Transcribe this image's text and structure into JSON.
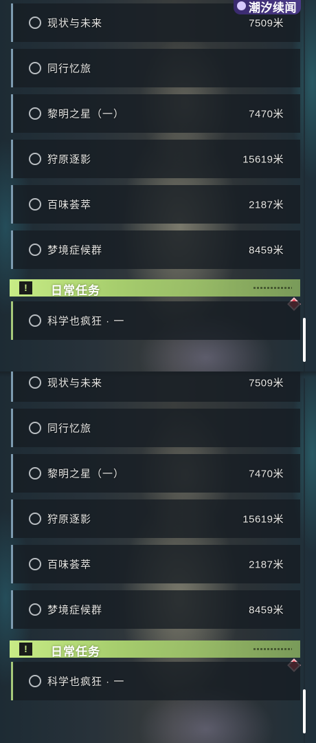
{
  "brand": {
    "name": "潮汐续闻"
  },
  "tasks": [
    {
      "name": "现状与未来",
      "distance": "7509米"
    },
    {
      "name": "同行忆旅",
      "distance": ""
    },
    {
      "name": "黎明之星（一）",
      "distance": "7470米"
    },
    {
      "name": "狩原逐影",
      "distance": "15619米"
    },
    {
      "name": "百味荟萃",
      "distance": "2187米"
    },
    {
      "name": "梦境症候群",
      "distance": "8459米"
    }
  ],
  "daily_section": {
    "title": "日常任务",
    "icon": "exclamation-icon",
    "items": [
      {
        "name": "科学也疯狂 · 一"
      }
    ]
  },
  "colors": {
    "accent_green": "#c8ec86",
    "new_marker": "#e23b4c",
    "item_border": "#7d9bb0"
  }
}
